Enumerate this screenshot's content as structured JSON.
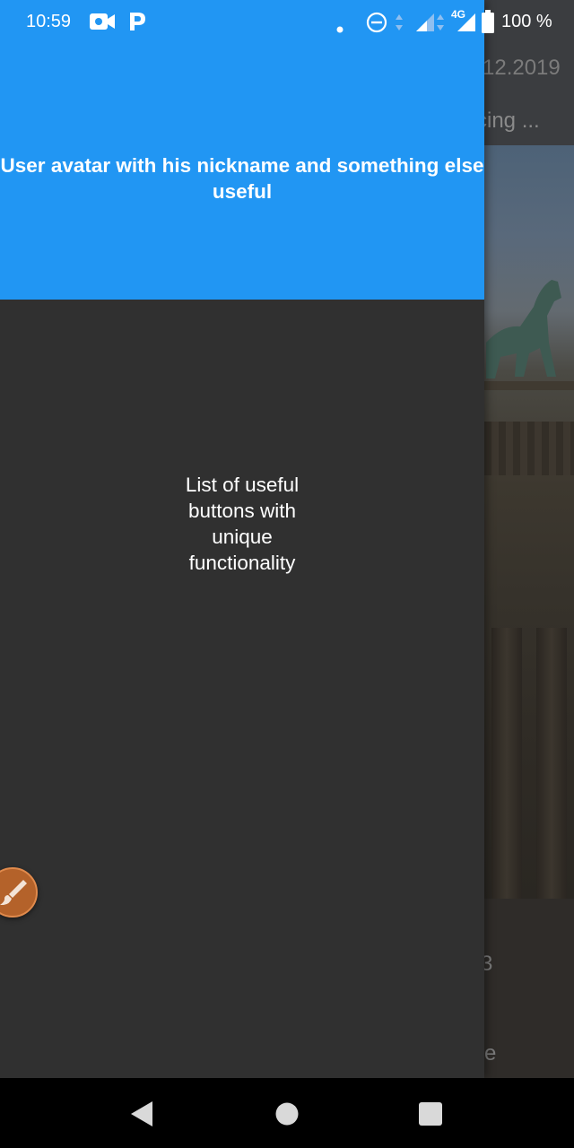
{
  "status_bar": {
    "time": "10:59",
    "network_label": "4G",
    "battery_text": "100 %",
    "icons": [
      "video-camera-icon",
      "parking-app-icon",
      "notification-dot-icon",
      "do-not-disturb-icon",
      "wifi-signal-icon",
      "cell-signal-icon",
      "battery-icon"
    ]
  },
  "background_app": {
    "date_fragment": "12.2019",
    "text_fragment": "cing ...",
    "lower_fragment_1": "3",
    "lower_fragment_2": "e"
  },
  "drawer": {
    "header": {
      "text": "User avatar with his nickname and something else useful",
      "color": "#2196f3"
    },
    "body": {
      "text": "List of useful buttons with unique functionality",
      "color": "#303030"
    }
  },
  "floating_button": {
    "icon": "brush-icon",
    "color": "#b4622a"
  },
  "nav_bar": {
    "buttons": [
      "back-icon",
      "home-icon",
      "recents-icon"
    ]
  }
}
